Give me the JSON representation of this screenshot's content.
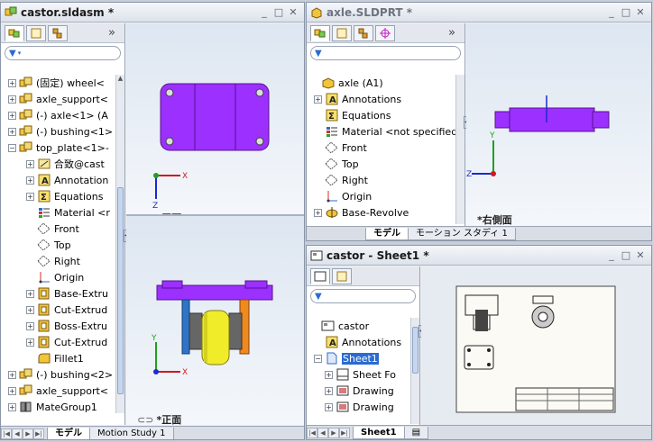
{
  "left_window": {
    "title": "castor.sldasm *",
    "tabs_more": "»",
    "tree": [
      {
        "label": "(固定) wheel<",
        "indent": 8,
        "exp": "+",
        "icon": "part"
      },
      {
        "label": "axle_support<",
        "indent": 8,
        "exp": "+",
        "icon": "part"
      },
      {
        "label": "(-) axle<1> (A",
        "indent": 8,
        "exp": "+",
        "icon": "part"
      },
      {
        "label": "(-) bushing<1>",
        "indent": 8,
        "exp": "+",
        "icon": "part"
      },
      {
        "label": "top_plate<1>-",
        "indent": 8,
        "exp": "−",
        "icon": "part"
      },
      {
        "label": "合致@cast",
        "indent": 28,
        "exp": "+",
        "icon": "mate"
      },
      {
        "label": "Annotation",
        "indent": 28,
        "exp": "+",
        "icon": "annot"
      },
      {
        "label": "Equations",
        "indent": 28,
        "exp": "+",
        "icon": "eq"
      },
      {
        "label": "Material <r",
        "indent": 28,
        "exp": "",
        "icon": "mat"
      },
      {
        "label": "Front",
        "indent": 28,
        "exp": "",
        "icon": "plane"
      },
      {
        "label": "Top",
        "indent": 28,
        "exp": "",
        "icon": "plane"
      },
      {
        "label": "Right",
        "indent": 28,
        "exp": "",
        "icon": "plane"
      },
      {
        "label": "Origin",
        "indent": 28,
        "exp": "",
        "icon": "origin"
      },
      {
        "label": "Base-Extru",
        "indent": 28,
        "exp": "+",
        "icon": "feat"
      },
      {
        "label": "Cut-Extrud",
        "indent": 28,
        "exp": "+",
        "icon": "feat"
      },
      {
        "label": "Boss-Extru",
        "indent": 28,
        "exp": "+",
        "icon": "feat"
      },
      {
        "label": "Cut-Extrud",
        "indent": 28,
        "exp": "+",
        "icon": "feat"
      },
      {
        "label": "Fillet1",
        "indent": 28,
        "exp": "",
        "icon": "fillet"
      },
      {
        "label": "(-) bushing<2>",
        "indent": 8,
        "exp": "+",
        "icon": "part"
      },
      {
        "label": "axle_support<",
        "indent": 8,
        "exp": "+",
        "icon": "part"
      },
      {
        "label": "MateGroup1",
        "indent": 8,
        "exp": "+",
        "icon": "mategroup"
      }
    ],
    "view_top_label": "*平面",
    "view_front_label": "*正面",
    "bottom_tabs": [
      "モデル",
      "Motion Study 1"
    ]
  },
  "right_top_window": {
    "title": "axle.SLDPRT *",
    "tabs_more": "»",
    "tree": [
      {
        "label": "axle  (A1)",
        "indent": 4,
        "exp": "",
        "icon": "partroot"
      },
      {
        "label": "Annotations",
        "indent": 8,
        "exp": "+",
        "icon": "annot"
      },
      {
        "label": "Equations",
        "indent": 8,
        "exp": "",
        "icon": "eq"
      },
      {
        "label": "Material <not specified>",
        "indent": 8,
        "exp": "",
        "icon": "mat"
      },
      {
        "label": "Front",
        "indent": 8,
        "exp": "",
        "icon": "plane"
      },
      {
        "label": "Top",
        "indent": 8,
        "exp": "",
        "icon": "plane"
      },
      {
        "label": "Right",
        "indent": 8,
        "exp": "",
        "icon": "plane"
      },
      {
        "label": "Origin",
        "indent": 8,
        "exp": "",
        "icon": "origin"
      },
      {
        "label": "Base-Revolve",
        "indent": 8,
        "exp": "+",
        "icon": "revolve"
      }
    ],
    "view_label": "*右側面",
    "bottom_tabs": [
      "モデル",
      "モーション スタディ 1"
    ]
  },
  "right_bottom_window": {
    "title": "castor - Sheet1 *",
    "tree": [
      {
        "label": "castor",
        "indent": 4,
        "exp": "",
        "icon": "drw"
      },
      {
        "label": "Annotations",
        "indent": 8,
        "exp": "",
        "icon": "annot"
      },
      {
        "label": "Sheet1",
        "indent": 8,
        "exp": "−",
        "icon": "sheet",
        "selected": true
      },
      {
        "label": "Sheet Fo",
        "indent": 20,
        "exp": "+",
        "icon": "sheetfmt"
      },
      {
        "label": "Drawing",
        "indent": 20,
        "exp": "+",
        "icon": "drwview"
      },
      {
        "label": "Drawing",
        "indent": 20,
        "exp": "+",
        "icon": "drwview"
      }
    ],
    "bottom_tabs": [
      "Sheet1"
    ]
  },
  "colors": {
    "purple": "#9b30ff",
    "orange": "#f08a1c",
    "yellow": "#f0ec2a",
    "blue": "#2e74c8",
    "accent": "#2a6bd0"
  }
}
